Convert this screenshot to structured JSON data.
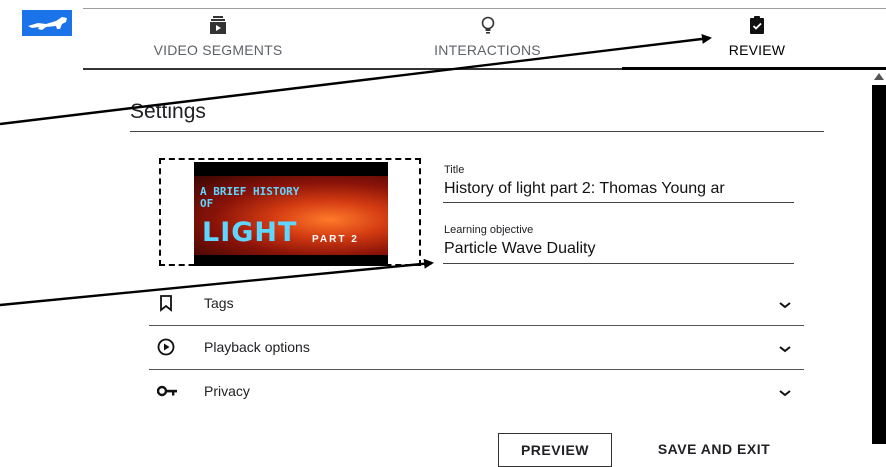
{
  "header": {
    "tabs": [
      {
        "label": "VIDEO SEGMENTS",
        "icon": "video-segments-icon"
      },
      {
        "label": "INTERACTIONS",
        "icon": "lightbulb-icon"
      },
      {
        "label": "REVIEW",
        "icon": "review-clipboard-icon",
        "active": true
      }
    ]
  },
  "settings": {
    "title": "Settings",
    "thumbnail": {
      "line1": "A BRIEF HISTORY",
      "line2": "OF",
      "line3": "LIGHT",
      "line4": "PART 2"
    },
    "fields": [
      {
        "label": "Title",
        "value": "History of light part 2: Thomas Young ar"
      },
      {
        "label": "Learning objective",
        "value": "Particle Wave Duality"
      }
    ],
    "sections": [
      {
        "label": "Tags",
        "icon": "bookmark-icon"
      },
      {
        "label": "Playback options",
        "icon": "play-circle-icon"
      },
      {
        "label": "Privacy",
        "icon": "key-icon"
      }
    ]
  },
  "actions": {
    "preview_label": "PREVIEW",
    "save_label": "SAVE AND EXIT"
  },
  "colors": {
    "logo": "#1a73e8",
    "accent_text": "#5fd6ff"
  }
}
